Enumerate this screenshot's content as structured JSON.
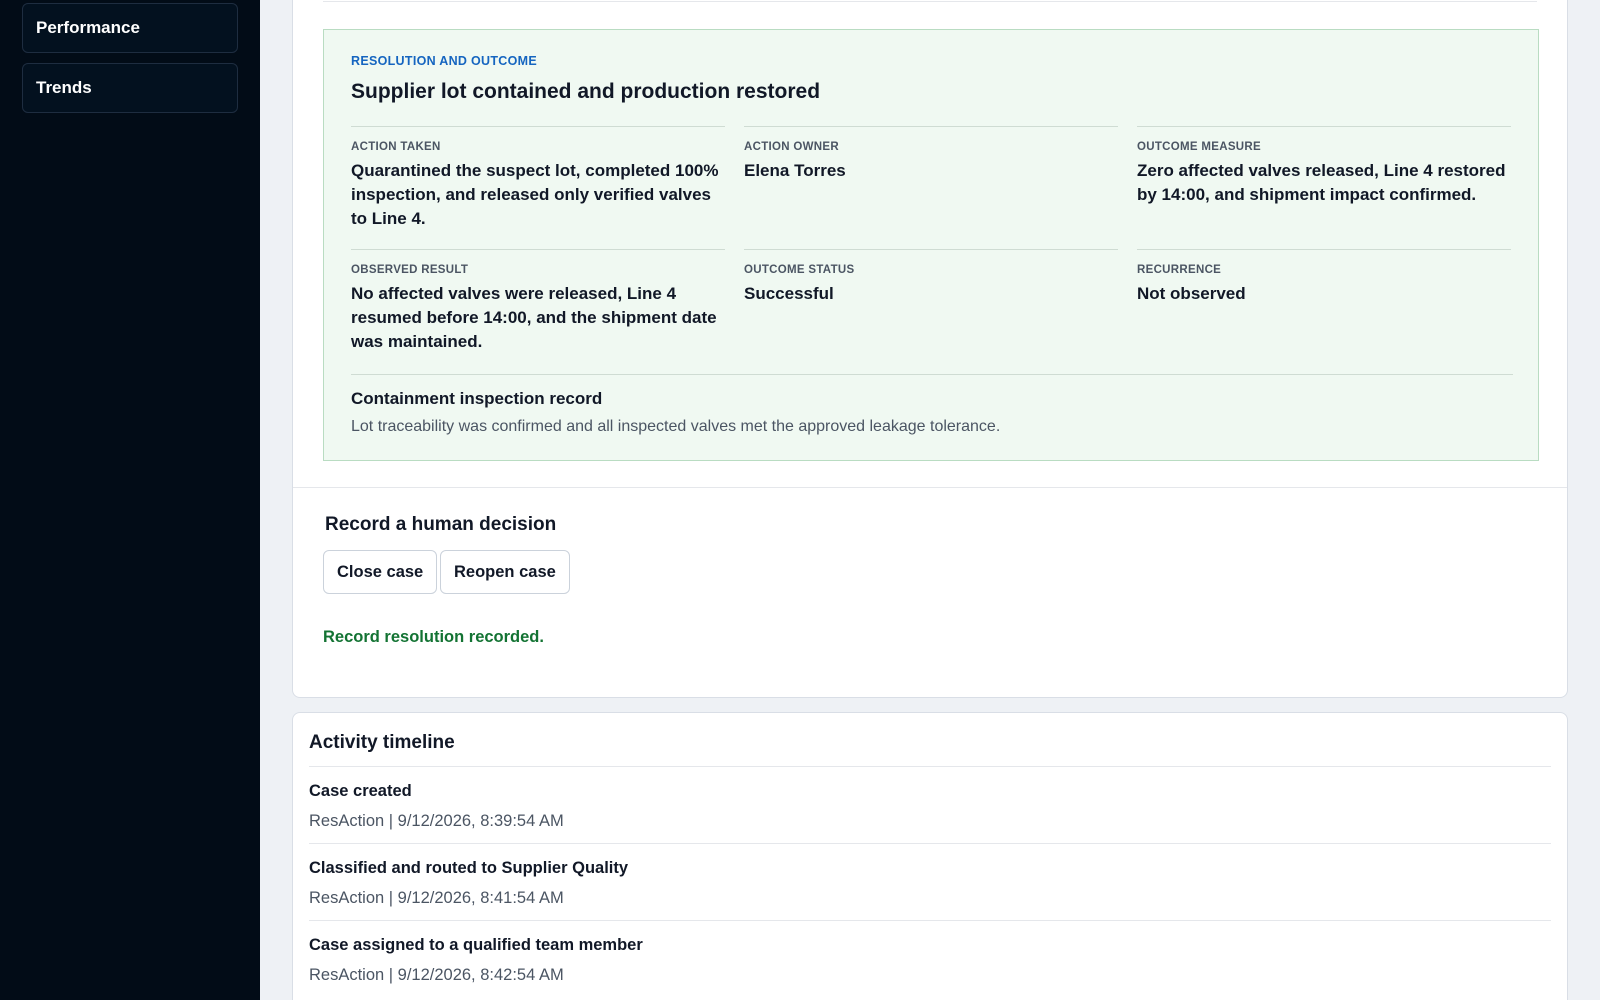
{
  "sidebar": {
    "items": [
      {
        "label": "Performance"
      },
      {
        "label": "Trends"
      }
    ]
  },
  "resolution": {
    "kicker": "RESOLUTION AND OUTCOME",
    "title": "Supplier lot contained and production restored",
    "fields": [
      {
        "label": "ACTION TAKEN",
        "value": "Quarantined the suspect lot, completed 100% inspection, and released only verified valves to Line 4."
      },
      {
        "label": "ACTION OWNER",
        "value": "Elena Torres"
      },
      {
        "label": "OUTCOME MEASURE",
        "value": "Zero affected valves released, Line 4 restored by 14:00, and shipment impact confirmed."
      },
      {
        "label": "OBSERVED RESULT",
        "value": "No affected valves were released, Line 4 resumed before 14:00, and the shipment date was maintained."
      },
      {
        "label": "OUTCOME STATUS",
        "value": "Successful"
      },
      {
        "label": "RECURRENCE",
        "value": "Not observed"
      }
    ],
    "record": {
      "title": "Containment inspection record",
      "text": "Lot traceability was confirmed and all inspected valves met the approved leakage tolerance."
    }
  },
  "decision": {
    "title": "Record a human decision",
    "close_label": "Close case",
    "reopen_label": "Reopen case",
    "status_message": "Record resolution recorded.",
    "status_color": "#137333"
  },
  "timeline": {
    "title": "Activity timeline",
    "items": [
      {
        "event": "Case created",
        "meta": "ResAction | 9/12/2026, 8:39:54 AM"
      },
      {
        "event": "Classified and routed to Supplier Quality",
        "meta": "ResAction | 9/12/2026, 8:41:54 AM"
      },
      {
        "event": "Case assigned to a qualified team member",
        "meta": "ResAction | 9/12/2026, 8:42:54 AM"
      }
    ]
  }
}
